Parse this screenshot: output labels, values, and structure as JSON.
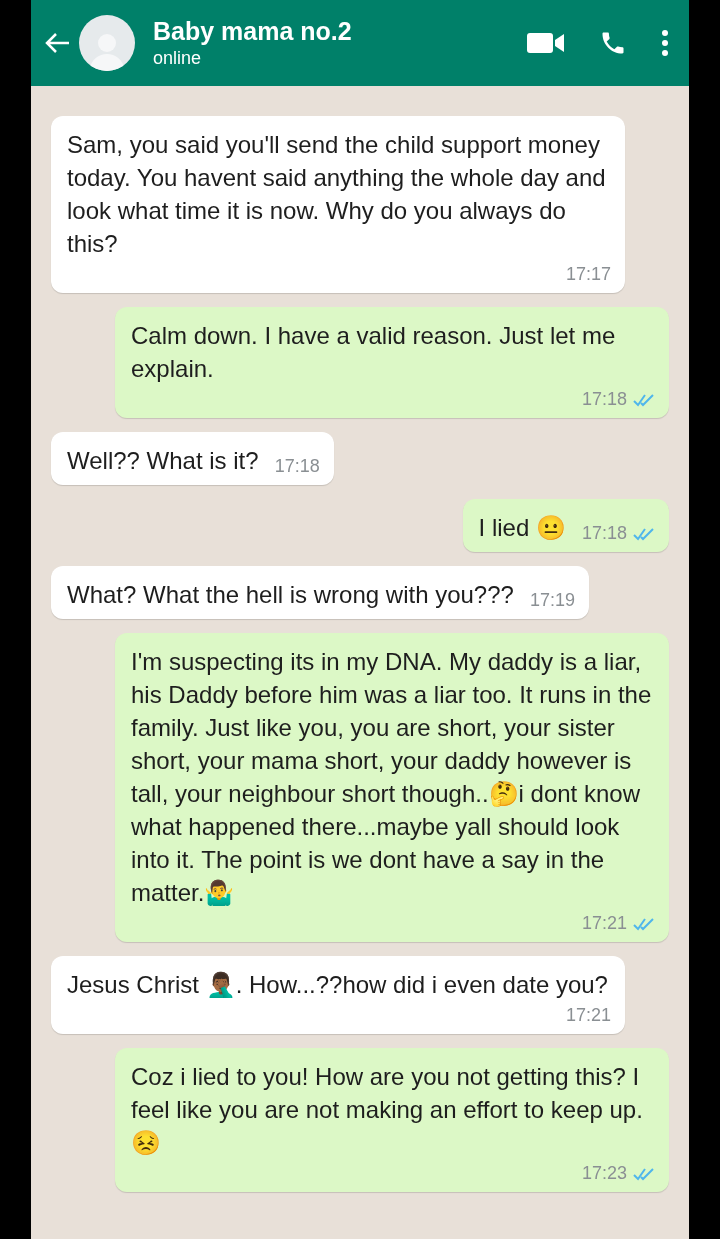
{
  "header": {
    "title": "Baby mama no.2",
    "status": "online"
  },
  "messages": [
    {
      "kind": "incoming",
      "text": "Sam, you said you'll send the child support money today. You havent said anything the whole day and look what time it is now. Why do you always do this?",
      "time": "17:17",
      "read": false
    },
    {
      "kind": "outgoing",
      "text": "Calm down. I have a valid reason. Just let me explain.",
      "time": "17:18",
      "read": true
    },
    {
      "kind": "incoming",
      "text": "Well?? What is it?",
      "time": "17:18",
      "read": false
    },
    {
      "kind": "outgoing",
      "text": "I lied 😐",
      "time": "17:18",
      "read": true
    },
    {
      "kind": "incoming",
      "text": "What? What the hell is wrong with you???",
      "time": "17:19",
      "read": false
    },
    {
      "kind": "outgoing",
      "text": "I'm suspecting its in my DNA. My daddy is a liar, his Daddy before him was a liar too. It runs in the family. Just like you, you are short, your sister short, your mama short, your daddy however is tall, your neighbour short though..🤔i dont know what happened there...maybe yall should look into it. The point is we dont have a say in the matter.🤷‍♂️",
      "time": "17:21",
      "read": true
    },
    {
      "kind": "incoming",
      "text": "Jesus Christ 🤦🏾‍♂️. How...??how did i even date you?",
      "time": "17:21",
      "read": false
    },
    {
      "kind": "outgoing",
      "text": "Coz i lied to you! How are you not getting this? I feel like you are not making an effort to keep up.😣",
      "time": "17:23",
      "read": true
    }
  ]
}
